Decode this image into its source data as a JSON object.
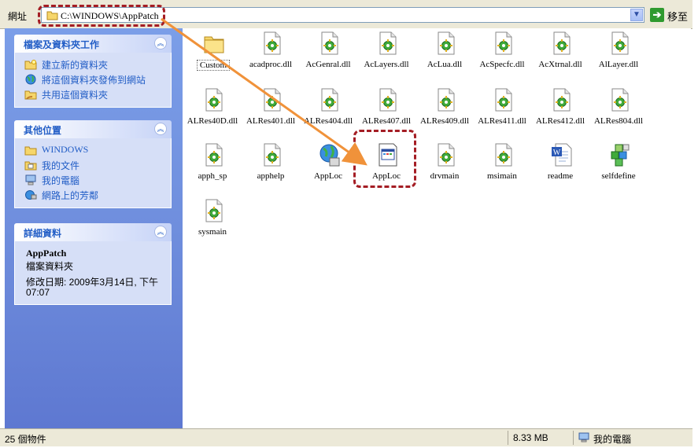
{
  "address_bar": {
    "label": "網址",
    "path": "C:\\WINDOWS\\AppPatch",
    "go_label": "移至"
  },
  "sidebar": {
    "file_tasks": {
      "title": "檔案及資料夾工作",
      "items": [
        {
          "label": "建立新的資料夾",
          "icon": "new-folder-icon"
        },
        {
          "label": "將這個資料夾發佈到網站",
          "icon": "globe-icon"
        },
        {
          "label": "共用這個資料夾",
          "icon": "share-folder-icon"
        }
      ]
    },
    "other_places": {
      "title": "其他位置",
      "items": [
        {
          "label": "WINDOWS",
          "icon": "folder-icon"
        },
        {
          "label": "我的文件",
          "icon": "my-documents-icon"
        },
        {
          "label": "我的電腦",
          "icon": "my-computer-icon"
        },
        {
          "label": "網路上的芳鄰",
          "icon": "network-icon"
        }
      ]
    },
    "details": {
      "title": "詳細資料",
      "name": "AppPatch",
      "type": "檔案資料夾",
      "modified": "修改日期: 2009年3月14日, 下午 07:07"
    }
  },
  "files": [
    {
      "name": "Custom",
      "icon": "folder-icon"
    },
    {
      "name": "acadproc.dll",
      "icon": "dll-icon"
    },
    {
      "name": "AcGenral.dll",
      "icon": "dll-icon"
    },
    {
      "name": "AcLayers.dll",
      "icon": "dll-icon"
    },
    {
      "name": "AcLua.dll",
      "icon": "dll-icon"
    },
    {
      "name": "AcSpecfc.dll",
      "icon": "dll-icon"
    },
    {
      "name": "AcXtrnal.dll",
      "icon": "dll-icon"
    },
    {
      "name": "AlLayer.dll",
      "icon": "dll-icon"
    },
    {
      "name": "ALRes40D.dll",
      "icon": "dll-icon"
    },
    {
      "name": "ALRes401.dll",
      "icon": "dll-icon"
    },
    {
      "name": "ALRes404.dll",
      "icon": "dll-icon"
    },
    {
      "name": "ALRes407.dll",
      "icon": "dll-icon"
    },
    {
      "name": "ALRes409.dll",
      "icon": "dll-icon"
    },
    {
      "name": "ALRes411.dll",
      "icon": "dll-icon"
    },
    {
      "name": "ALRes412.dll",
      "icon": "dll-icon"
    },
    {
      "name": "ALRes804.dll",
      "icon": "dll-icon"
    },
    {
      "name": "apph_sp",
      "icon": "dll-icon"
    },
    {
      "name": "apphelp",
      "icon": "dll-icon"
    },
    {
      "name": "AppLoc",
      "icon": "globe-app-icon"
    },
    {
      "name": "AppLoc",
      "icon": "application-window-icon"
    },
    {
      "name": "drvmain",
      "icon": "dll-icon"
    },
    {
      "name": "msimain",
      "icon": "dll-icon"
    },
    {
      "name": "readme",
      "icon": "word-document-icon"
    },
    {
      "name": "selfdefine",
      "icon": "blocks-icon"
    },
    {
      "name": "sysmain",
      "icon": "dll-icon"
    }
  ],
  "status_bar": {
    "count": "25 個物件",
    "size": "8.33 MB",
    "location": "我的電腦"
  },
  "colors": {
    "callout": "#a41d24",
    "arrow": "#f0923a",
    "sidebar_link": "#215dc6"
  }
}
